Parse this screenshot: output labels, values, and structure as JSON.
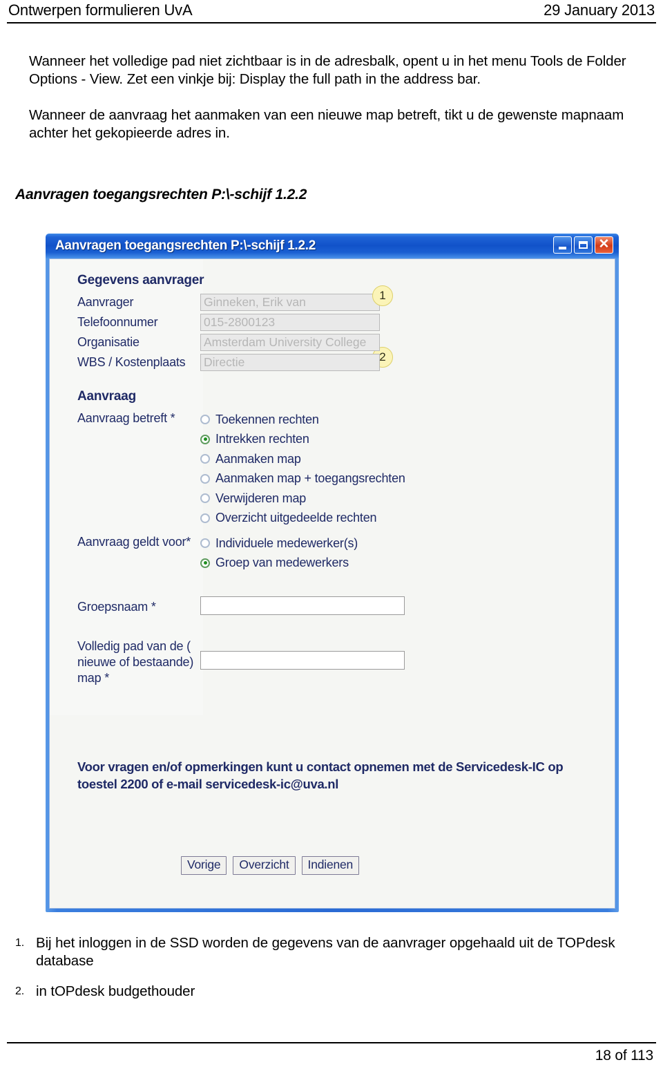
{
  "header": {
    "left_title": "Ontwerpen formulieren UvA",
    "right_date": "29 January 2013"
  },
  "body": {
    "paragraph_1": "Wanneer het volledige pad niet zichtbaar is in de adresbalk, opent u in het menu Tools de Folder Options - View. Zet een vinkje bij: Display the full path in the address bar.",
    "paragraph_2": "Wanneer de aanvraag het aanmaken van een nieuwe map betreft, tikt u de gewenste mapnaam achter het gekopieerde adres in.",
    "section_title": "Aanvragen toegangsrechten P:\\-schijf 1.2.2"
  },
  "dialog": {
    "title": "Aanvragen toegangsrechten P:\\-schijf 1.2.2",
    "window_controls": {
      "minimize": "minimize-icon",
      "maximize": "maximize-icon",
      "close": "close-icon"
    },
    "applicant_section": {
      "heading": "Gegevens aanvrager",
      "fields": [
        {
          "label": "Aanvrager",
          "value": "Ginneken, Erik van"
        },
        {
          "label": "Telefoonnumer",
          "value": "015-2800123"
        },
        {
          "label": "Organisatie",
          "value": "Amsterdam University College"
        },
        {
          "label": "WBS / Kostenplaats",
          "value": "Directie"
        }
      ],
      "callouts": [
        {
          "number": "1"
        },
        {
          "number": "2"
        }
      ]
    },
    "request_section": {
      "heading": "Aanvraag",
      "betreft_label": "Aanvraag betreft *",
      "betreft_options": [
        {
          "label": "Toekennen rechten",
          "selected": false
        },
        {
          "label": "Intrekken rechten",
          "selected": true
        },
        {
          "label": "Aanmaken map",
          "selected": false
        },
        {
          "label": "Aanmaken map + toegangsrechten",
          "selected": false
        },
        {
          "label": "Verwijderen map",
          "selected": false
        },
        {
          "label": "Overzicht uitgedeelde rechten",
          "selected": false
        }
      ],
      "geldt_label": "Aanvraag geldt voor*",
      "geldt_options": [
        {
          "label": "Individuele medewerker(s)",
          "selected": false
        },
        {
          "label": "Groep van medewerkers",
          "selected": true
        }
      ]
    },
    "text_fields": [
      {
        "label": "Groepsnaam *",
        "value": ""
      },
      {
        "label": "Volledig pad van de ( nieuwe of bestaande) map *",
        "value": ""
      }
    ],
    "contact_note": "Voor vragen en/of opmerkingen kunt u contact opnemen met de Servicedesk-IC op toestel 2200 of e-mail servicedesk-ic@uva.nl",
    "buttons": [
      {
        "label": "Vorige"
      },
      {
        "label": "Overzicht"
      },
      {
        "label": "Indienen"
      }
    ]
  },
  "notes": [
    {
      "number": "1.",
      "text": "Bij het inloggen in de SSD worden de gegevens van de aanvrager opgehaald uit de TOPdesk database"
    },
    {
      "number": "2.",
      "text": "in tOPdesk budgethouder"
    }
  ],
  "footer": {
    "page_label": "18 of 113"
  },
  "colors": {
    "titlebar_blue": "#1152c9",
    "label_navy": "#1f2a66",
    "badge_yellow": "#fbf4b8",
    "radio_green": "#1f8f1f",
    "close_red": "#d33b18"
  }
}
